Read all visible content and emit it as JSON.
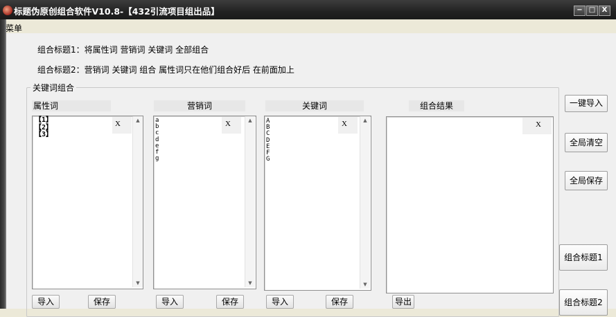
{
  "window": {
    "title": "标题伪原创组合软件V10.8-【432引流项目组出品】",
    "min": "−",
    "max": "□",
    "close": "X"
  },
  "menu": {
    "item": "菜单"
  },
  "description": {
    "line1": "组合标题1：将属性词 营销词 关键词 全部组合",
    "line2": "组合标题2：营销词 关键词 组合 属性词只在他们组合好后 在前面加上"
  },
  "group": {
    "legend": "关键词组合"
  },
  "columns": [
    {
      "head": "属性词",
      "content": "【1】\n【2】\n【3】",
      "clear": "X",
      "import": "导入",
      "save": "保存"
    },
    {
      "head": "营销词",
      "content": "a\nb\nc\nd\ne\nf\ng",
      "clear": "X",
      "import": "导入",
      "save": "保存"
    },
    {
      "head": "关键词",
      "content": "A\nB\nC\nD\nE\nF\nG",
      "clear": "X",
      "import": "导入",
      "save": "保存"
    },
    {
      "head": "组合结果",
      "content": "",
      "clear": "X",
      "export": "导出"
    }
  ],
  "scroll": {
    "up": "▲",
    "down": "▼"
  },
  "right_buttons": {
    "import_all": "一键导入",
    "clear_all": "全局清空",
    "save_all": "全局保存",
    "combine1": "组合标题1",
    "combine2": "组合标题2"
  }
}
